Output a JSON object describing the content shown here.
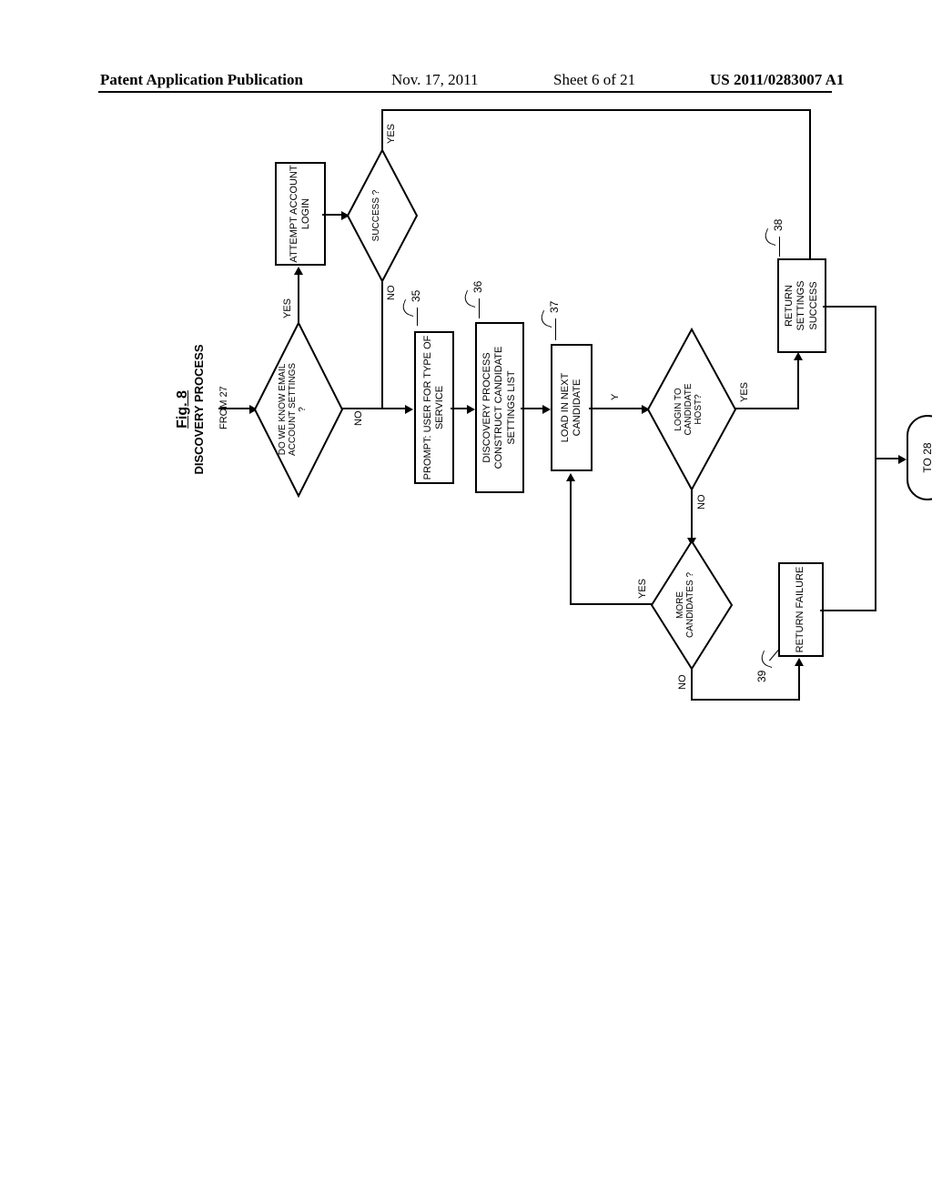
{
  "header": {
    "left": "Patent Application Publication",
    "date": "Nov. 17, 2011",
    "sheet": "Sheet 6 of 21",
    "pubno": "US 2011/0283007 A1"
  },
  "fig": {
    "num": "Fig. 8",
    "title": "DISCOVERY PROCESS"
  },
  "from": "FROM 27",
  "to": "TO 28",
  "nodes": {
    "d_know": "DO WE KNOW\nEMAIL ACCOUNT\nSETTINGS\n?",
    "attempt": "ATTEMPT\nACCOUNT\nLOGIN",
    "d_success": "SUCCESS\n?",
    "prompt": "PROMPT: USER FOR\nTYPE OF SERVICE",
    "construct": "DISCOVERY PROCESS\nCONSTRUCT CANDIDATE\nSETTINGS LIST",
    "loadnext": "LOAD IN NEXT\nCANDIDATE",
    "d_login": "LOGIN TO\nCANDIDATE\nHOST?",
    "d_more": "MORE\nCANDIDATES\n?",
    "ret_success": "RETURN\nSETTINGS\nSUCCESS",
    "ret_fail": "RETURN\nFAILURE"
  },
  "edges": {
    "yes": "YES",
    "no": "NO",
    "y": "Y"
  },
  "refs": {
    "r35": "35",
    "r36": "36",
    "r37": "37",
    "r38": "38",
    "r39": "39"
  },
  "chart_data": {
    "type": "flowchart",
    "title": "Fig. 8 — DISCOVERY PROCESS",
    "entry": "FROM 27",
    "exit": "TO 28",
    "nodes": [
      {
        "id": "from27",
        "kind": "offpage",
        "label": "FROM 27"
      },
      {
        "id": "know",
        "kind": "decision",
        "label": "DO WE KNOW EMAIL ACCOUNT SETTINGS ?"
      },
      {
        "id": "attempt",
        "kind": "process",
        "label": "ATTEMPT ACCOUNT LOGIN"
      },
      {
        "id": "success",
        "kind": "decision",
        "label": "SUCCESS ?"
      },
      {
        "id": "prompt",
        "kind": "process",
        "label": "PROMPT: USER FOR TYPE OF SERVICE",
        "ref": 35
      },
      {
        "id": "construct",
        "kind": "process",
        "label": "DISCOVERY PROCESS CONSTRUCT CANDIDATE SETTINGS LIST",
        "ref": 36
      },
      {
        "id": "loadnext",
        "kind": "process",
        "label": "LOAD IN NEXT CANDIDATE",
        "ref": 37
      },
      {
        "id": "loginhost",
        "kind": "decision",
        "label": "LOGIN TO CANDIDATE HOST?"
      },
      {
        "id": "more",
        "kind": "decision",
        "label": "MORE CANDIDATES ?"
      },
      {
        "id": "retsucc",
        "kind": "process",
        "label": "RETURN SETTINGS SUCCESS",
        "ref": 38
      },
      {
        "id": "retfail",
        "kind": "process",
        "label": "RETURN FAILURE",
        "ref": 39
      },
      {
        "id": "to28",
        "kind": "terminator",
        "label": "TO 28"
      }
    ],
    "edges": [
      {
        "from": "from27",
        "to": "know"
      },
      {
        "from": "know",
        "to": "attempt",
        "label": "YES"
      },
      {
        "from": "know",
        "to": "prompt",
        "label": "NO"
      },
      {
        "from": "attempt",
        "to": "success"
      },
      {
        "from": "success",
        "to": "retsucc",
        "label": "YES"
      },
      {
        "from": "success",
        "to": "prompt",
        "label": "NO"
      },
      {
        "from": "prompt",
        "to": "construct"
      },
      {
        "from": "construct",
        "to": "loadnext"
      },
      {
        "from": "loadnext",
        "to": "loginhost",
        "label": "Y"
      },
      {
        "from": "loginhost",
        "to": "retsucc",
        "label": "YES"
      },
      {
        "from": "loginhost",
        "to": "more",
        "label": "NO"
      },
      {
        "from": "more",
        "to": "loadnext",
        "label": "YES"
      },
      {
        "from": "more",
        "to": "retfail",
        "label": "NO"
      },
      {
        "from": "retsucc",
        "to": "to28"
      },
      {
        "from": "retfail",
        "to": "to28"
      }
    ]
  }
}
